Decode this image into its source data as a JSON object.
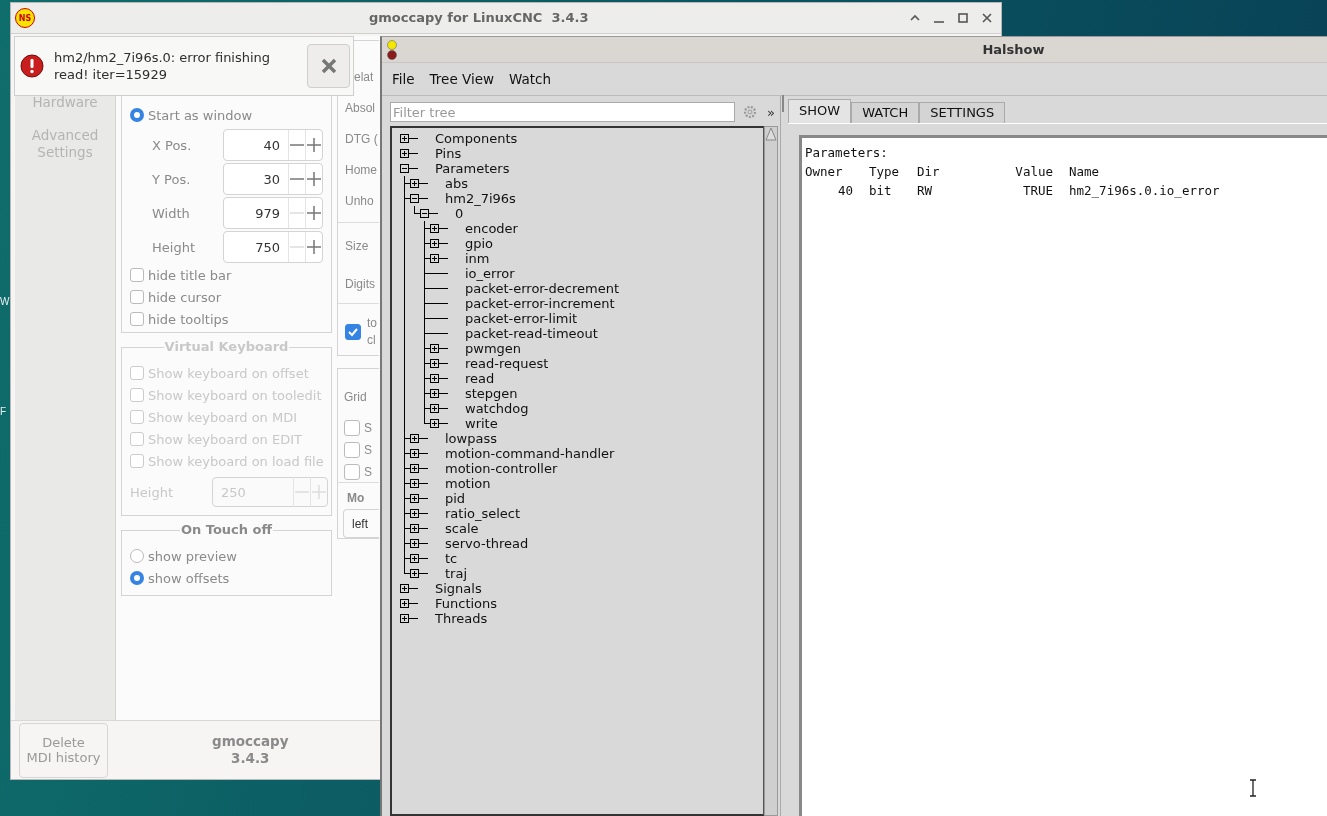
{
  "desktop": {
    "labels": [
      "W",
      "F"
    ]
  },
  "gmoccapy": {
    "title": "gmoccapy for LinuxCNC  3.4.3",
    "logo": "NS",
    "sidebar": [
      {
        "label": "Hardware"
      },
      {
        "label": "Advanced Settings"
      }
    ],
    "window_mode": [
      {
        "label": "Start as window",
        "selected": true
      }
    ],
    "position_fields": [
      {
        "label": "X Pos.",
        "value": "40",
        "minus_enabled": true
      },
      {
        "label": "Y Pos.",
        "value": "30",
        "minus_enabled": true
      },
      {
        "label": "Width",
        "value": "979",
        "minus_enabled": false
      },
      {
        "label": "Height",
        "value": "750",
        "minus_enabled": false
      }
    ],
    "options": [
      {
        "label": "hide title bar",
        "checked": false
      },
      {
        "label": "hide cursor",
        "checked": false
      },
      {
        "label": "hide tooltips",
        "checked": false
      }
    ],
    "virtual_keyboard": {
      "title": "Virtual Keyboard",
      "disabled": true,
      "options": [
        {
          "label": "Show keyboard on offset",
          "checked": false
        },
        {
          "label": "Show keyboard on tooledit",
          "checked": false
        },
        {
          "label": "Show keyboard on MDI",
          "checked": false
        },
        {
          "label": "Show keyboard on EDIT",
          "checked": false
        },
        {
          "label": "Show keyboard on load file",
          "checked": false
        }
      ],
      "height": {
        "label": "Height",
        "value": "250"
      }
    },
    "touch_off": {
      "title": "On Touch off",
      "options": [
        {
          "label": "show preview",
          "selected": false
        },
        {
          "label": "show offsets",
          "selected": true
        }
      ]
    },
    "cut_column": {
      "labels": [
        "elat",
        "Absol",
        "DTG (",
        "Home",
        "Unho"
      ],
      "labels_2": [
        "Size",
        "Digits"
      ],
      "check": {
        "checked": true,
        "lines": [
          "to",
          "cl"
        ]
      },
      "grid_label": "Grid",
      "grid_checks": [
        {
          "label": "S",
          "checked": false
        },
        {
          "label": "S",
          "checked": false
        },
        {
          "label": "S",
          "checked": false
        }
      ],
      "heading": "Mo",
      "dropdown": "left"
    },
    "delete_button": [
      "Delete",
      "MDI history"
    ],
    "version": [
      "gmoccapy",
      "3.4.3"
    ]
  },
  "notification": {
    "message": "hm2/hm2_7i96s.0: error finishing read! iter=15929"
  },
  "halshow": {
    "title": "Halshow",
    "menu": [
      "File",
      "Tree View",
      "Watch"
    ],
    "filter": {
      "placeholder": "Filter tree"
    },
    "expand_label": "»",
    "tree": [
      {
        "label": "Components",
        "kind": "branch",
        "expanded": false
      },
      {
        "label": "Pins",
        "kind": "branch",
        "expanded": false
      },
      {
        "label": "Parameters",
        "kind": "branch",
        "expanded": true,
        "children": [
          {
            "label": "abs",
            "kind": "branch",
            "expanded": false
          },
          {
            "label": "hm2_7i96s",
            "kind": "branch",
            "expanded": true,
            "children": [
              {
                "label": "0",
                "kind": "branch",
                "expanded": true,
                "children": [
                  {
                    "label": "encoder",
                    "kind": "branch",
                    "expanded": false
                  },
                  {
                    "label": "gpio",
                    "kind": "branch",
                    "expanded": false
                  },
                  {
                    "label": "inm",
                    "kind": "branch",
                    "expanded": false
                  },
                  {
                    "label": "io_error",
                    "kind": "leaf"
                  },
                  {
                    "label": "packet-error-decrement",
                    "kind": "leaf"
                  },
                  {
                    "label": "packet-error-increment",
                    "kind": "leaf"
                  },
                  {
                    "label": "packet-error-limit",
                    "kind": "leaf"
                  },
                  {
                    "label": "packet-read-timeout",
                    "kind": "leaf"
                  },
                  {
                    "label": "pwmgen",
                    "kind": "branch",
                    "expanded": false
                  },
                  {
                    "label": "read-request",
                    "kind": "branch",
                    "expanded": false
                  },
                  {
                    "label": "read",
                    "kind": "branch",
                    "expanded": false
                  },
                  {
                    "label": "stepgen",
                    "kind": "branch",
                    "expanded": false
                  },
                  {
                    "label": "watchdog",
                    "kind": "branch",
                    "expanded": false
                  },
                  {
                    "label": "write",
                    "kind": "branch",
                    "expanded": false
                  }
                ]
              }
            ]
          },
          {
            "label": "lowpass",
            "kind": "branch",
            "expanded": false
          },
          {
            "label": "motion-command-handler",
            "kind": "branch",
            "expanded": false
          },
          {
            "label": "motion-controller",
            "kind": "branch",
            "expanded": false
          },
          {
            "label": "motion",
            "kind": "branch",
            "expanded": false
          },
          {
            "label": "pid",
            "kind": "branch",
            "expanded": false
          },
          {
            "label": "ratio_select",
            "kind": "branch",
            "expanded": false
          },
          {
            "label": "scale",
            "kind": "branch",
            "expanded": false
          },
          {
            "label": "servo-thread",
            "kind": "branch",
            "expanded": false
          },
          {
            "label": "tc",
            "kind": "branch",
            "expanded": false
          },
          {
            "label": "traj",
            "kind": "branch",
            "expanded": false
          }
        ]
      },
      {
        "label": "Signals",
        "kind": "branch",
        "expanded": false
      },
      {
        "label": "Functions",
        "kind": "branch",
        "expanded": false
      },
      {
        "label": "Threads",
        "kind": "branch",
        "expanded": false
      }
    ],
    "tabs": [
      {
        "label": "SHOW",
        "selected": true
      },
      {
        "label": "WATCH",
        "selected": false
      },
      {
        "label": "SETTINGS",
        "selected": false
      }
    ],
    "show": {
      "heading": "Parameters:",
      "columns": [
        "Owner",
        "Type",
        "Dir",
        "Value",
        "Name"
      ],
      "rows": [
        [
          "40",
          "bit",
          "RW",
          "TRUE",
          "hm2_7i96s.0.io_error"
        ]
      ]
    }
  }
}
